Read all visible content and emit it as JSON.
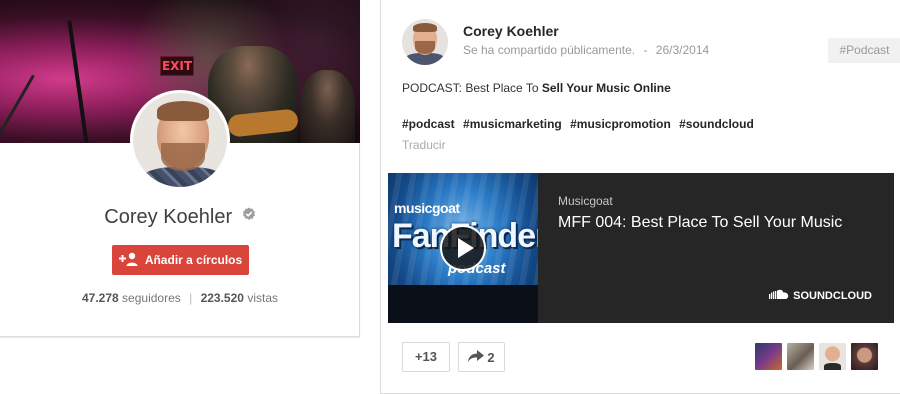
{
  "profile": {
    "name": "Corey Koehler",
    "cover_exit_sign": "EXIT",
    "add_button_label": "Añadir a círculos",
    "followers_count": "47.278",
    "followers_label": "seguidores",
    "separator": "|",
    "views_count": "223.520",
    "views_label": "vistas"
  },
  "post": {
    "author": "Corey Koehler",
    "visibility": "Se ha compartido públicamente.",
    "dash": "-",
    "date": "26/3/2014",
    "tag": "#Podcast",
    "text_prefix": "PODCAST: Best Place To ",
    "text_bold": "Sell Your Music Online",
    "hashtags": [
      "#podcast",
      "#musicmarketing",
      "#musicpromotion",
      "#soundcloud"
    ],
    "translate_label": "Traducir",
    "embed": {
      "thumb_logo_top": "musicgoat",
      "thumb_logo_main": "FanFinder",
      "thumb_logo_sub": "podcast",
      "source": "Musicgoat",
      "title": "MFF 004: Best Place To Sell Your Music",
      "provider": "SOUNDCLOUD"
    },
    "plus_one_label": "+13",
    "share_count": "2"
  },
  "colors": {
    "accent_red": "#d9453a",
    "embed_bg": "#262626",
    "tag_bg": "#f1f1f1"
  },
  "icons": {
    "verified": "verified-check-icon",
    "add_person": "add-person-icon",
    "play": "play-icon",
    "soundcloud": "soundcloud-cloud-icon",
    "share": "share-arrow-icon"
  }
}
